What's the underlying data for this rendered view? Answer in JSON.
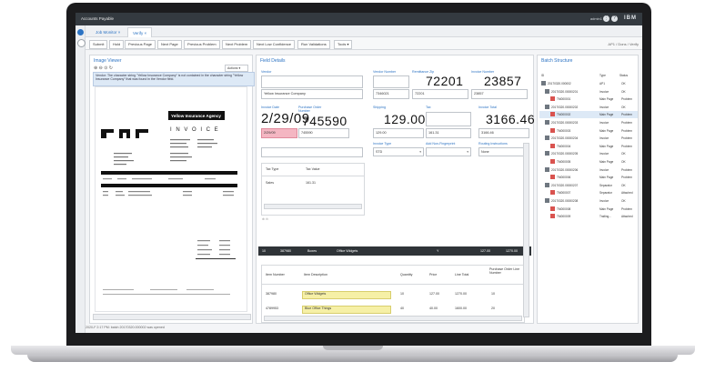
{
  "app": {
    "title": "Accounts Payable",
    "user_label": "admin1"
  },
  "tabs": [
    {
      "label": "Job Monitor"
    },
    {
      "label": "Verify"
    }
  ],
  "toolbar": {
    "buttons": [
      "Submit",
      "Hold",
      "Previous Page",
      "Next Page",
      "Previous Problem",
      "Next Problem",
      "Next Low Confidence",
      "Run Validations",
      "Tools"
    ],
    "breadcrumb": "AP1 / Dons / Verify"
  },
  "viewer": {
    "title": "Image Viewer",
    "actions_label": "Actions",
    "message": "Vendor: The character string \"Yellow Insurance Company\" is not contained in the character string \"Yellow Insurance Company\" that was found in the Vendor field."
  },
  "document": {
    "logo_text": "Yellow Insurance Agency",
    "invoice_word": "I N V O I C E"
  },
  "fields": {
    "title": "Field Details",
    "vendor_label": "Vendor",
    "vendor_value": "Yellow Insurance Company",
    "vendor_number_label": "Vendor Number",
    "vendor_number_value": "7346021",
    "remit_zip_label": "Remittance Zip",
    "remit_zip_big": "72201",
    "remit_zip_value": "72201",
    "invoice_number_label": "Invoice Number",
    "invoice_number_big": "23857",
    "invoice_number_value": "23857",
    "invoice_date_label": "Invoice Date",
    "invoice_date_big": "2/29/09",
    "invoice_date_value": "2/29/09",
    "po_number_label": "Purchase Order Number",
    "po_number_big": "745590",
    "po_number_value": "745590",
    "shipping_label": "Shipping",
    "shipping_big": "129.00",
    "shipping_value": "129.00",
    "tax_label": "Tax",
    "tax_value": "161.31",
    "invoice_total_label": "Invoice Total",
    "invoice_total_big": "3166.46",
    "invoice_total_value": "3166.46",
    "invoice_type_label": "Invoice Type",
    "invoice_type_value": "STD",
    "add_non_fingerprint_label": "Add Non-Fingerprint",
    "routing_label": "Routing Instructions",
    "routing_value": "None",
    "tax_table": {
      "headers": [
        "Tax Type",
        "Tax Value"
      ],
      "rows": [
        [
          "Sales",
          "161.31"
        ]
      ]
    },
    "dark_row": [
      "10",
      "387980",
      "Boxes",
      "Office Widgets",
      "Y",
      "127.00",
      "1270.00"
    ],
    "line_items": {
      "headers": [
        "Item Number",
        "Item Description",
        "Quantity",
        "Price",
        "Line Total",
        "Purchase Order Line Number"
      ],
      "rows": [
        [
          "387980",
          "Office Widgets",
          "10",
          "127.00",
          "1270.00",
          "10"
        ],
        [
          "4789953",
          "Blue Office Things",
          "40",
          "40.00",
          "1600.00",
          "20"
        ]
      ]
    }
  },
  "batch": {
    "title": "Batch Structure",
    "headers": [
      "ID",
      "Type",
      "Status"
    ],
    "rows": [
      {
        "id": "20170320.000002",
        "type": "AP1",
        "status": "OK"
      },
      {
        "id": "20170320.00000201",
        "type": "Invoice",
        "status": "OK"
      },
      {
        "id": "TM000001",
        "type": "Main Page",
        "status": "Problem"
      },
      {
        "id": "20170320.00000202",
        "type": "Invoice",
        "status": "OK"
      },
      {
        "id": "TM000002",
        "type": "Main Page",
        "status": "Problem"
      },
      {
        "id": "20170320.00000203",
        "type": "Invoice",
        "status": "Problem"
      },
      {
        "id": "TM000003",
        "type": "Main Page",
        "status": "Problem"
      },
      {
        "id": "20170320.00000204",
        "type": "Invoice",
        "status": "Problem"
      },
      {
        "id": "TM000004",
        "type": "Main Page",
        "status": "Problem"
      },
      {
        "id": "20170320.00000205",
        "type": "Invoice",
        "status": "OK"
      },
      {
        "id": "TM000005",
        "type": "Main Page",
        "status": "OK"
      },
      {
        "id": "20170320.00000206",
        "type": "Invoice",
        "status": "Problem"
      },
      {
        "id": "TM000006",
        "type": "Main Page",
        "status": "Problem"
      },
      {
        "id": "20170320.00000207",
        "type": "Separator",
        "status": "OK"
      },
      {
        "id": "TM000007",
        "type": "Separator",
        "status": "Attached"
      },
      {
        "id": "20170320.00000208",
        "type": "Invoice",
        "status": "OK"
      },
      {
        "id": "TM000008",
        "type": "Main Page",
        "status": "Problem"
      },
      {
        "id": "TM000009",
        "type": "Trailing...",
        "status": "Attached"
      }
    ]
  },
  "status_bar": "2020-F 2:17 PM: batch 20170320.000002 was opened",
  "colors": {
    "accent": "#2c73c3",
    "topbar": "#343a40",
    "problem_highlight": "#f4b6c2",
    "row_highlight": "#f6f0a6"
  }
}
